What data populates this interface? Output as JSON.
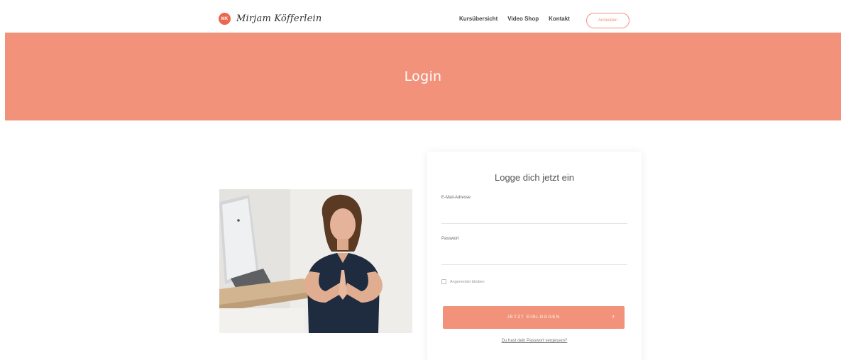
{
  "brand": {
    "badge_text": "MK",
    "name": "Mirjam Köfferlein",
    "accent_color": "#f2927a",
    "badge_color": "#ec6650"
  },
  "nav": {
    "items": [
      {
        "label": "Kursübersicht"
      },
      {
        "label": "Video Shop"
      },
      {
        "label": "Kontakt"
      }
    ],
    "button_label": "Anmelden"
  },
  "hero": {
    "title": "Login"
  },
  "photo": {
    "icon": "woman-namaste-photo"
  },
  "login": {
    "title": "Logge dich jetzt ein",
    "email_label": "E-Mail-Adresse",
    "email_value": "",
    "password_label": "Passwort",
    "password_value": "",
    "remember_label": "Angemeldet bleiben",
    "submit_label": "JETZT EINLOGGEN",
    "submit_icon": "arrow-right-icon",
    "forgot_label": "Du hast dein Passwort vergessen?"
  }
}
